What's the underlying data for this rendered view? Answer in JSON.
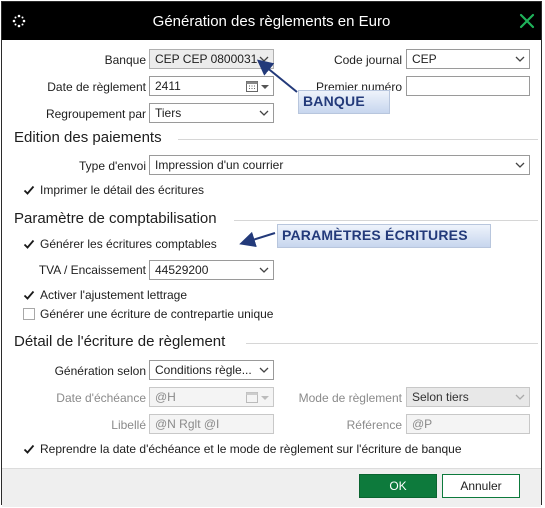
{
  "window": {
    "title": "Génération des règlements en Euro"
  },
  "top": {
    "banque_label": "Banque",
    "banque_value": "CEP CEP 0800031...",
    "code_journal_label": "Code journal",
    "code_journal_value": "CEP",
    "date_label": "Date de règlement",
    "date_value": "2411",
    "premier_numero_label": "Premier numéro",
    "premier_numero_value": "",
    "regroupement_label": "Regroupement par",
    "regroupement_value": "Tiers"
  },
  "edition": {
    "title": "Edition des paiements",
    "type_envoi_label": "Type d'envoi",
    "type_envoi_value": "Impression d'un courrier",
    "imprimer_label": "Imprimer le détail des écritures",
    "imprimer_checked": true
  },
  "parametres": {
    "title": "Paramètre de comptabilisation",
    "generer_label": "Générer les écritures comptables",
    "generer_checked": true,
    "tva_label": "TVA / Encaissement",
    "tva_value": "44529200",
    "ajustement_label": "Activer l'ajustement lettrage",
    "ajustement_checked": true,
    "contrepartie_label": "Générer une écriture de contrepartie unique",
    "contrepartie_checked": false
  },
  "detail": {
    "title": "Détail de l'écriture de règlement",
    "generation_label": "Génération selon",
    "generation_value": "Conditions règle...",
    "echeance_label": "Date d'échéance",
    "echeance_value": "@H",
    "mode_label": "Mode de règlement",
    "mode_value": "Selon tiers",
    "libelle_label": "Libellé",
    "libelle_value": "@N Rglt @I",
    "reference_label": "Référence",
    "reference_value": "@P",
    "reprendre_label": "Reprendre la date d'échéance et le mode de règlement sur l'écriture de banque",
    "reprendre_checked": true
  },
  "annotations": {
    "banque": "BANQUE",
    "parametres": "PARAMÈTRES ÉCRITURES"
  },
  "buttons": {
    "ok": "OK",
    "cancel": "Annuler"
  },
  "colors": {
    "accent": "#0d7a3c",
    "annotation_text": "#233a7a",
    "titlebar": "#000000"
  }
}
